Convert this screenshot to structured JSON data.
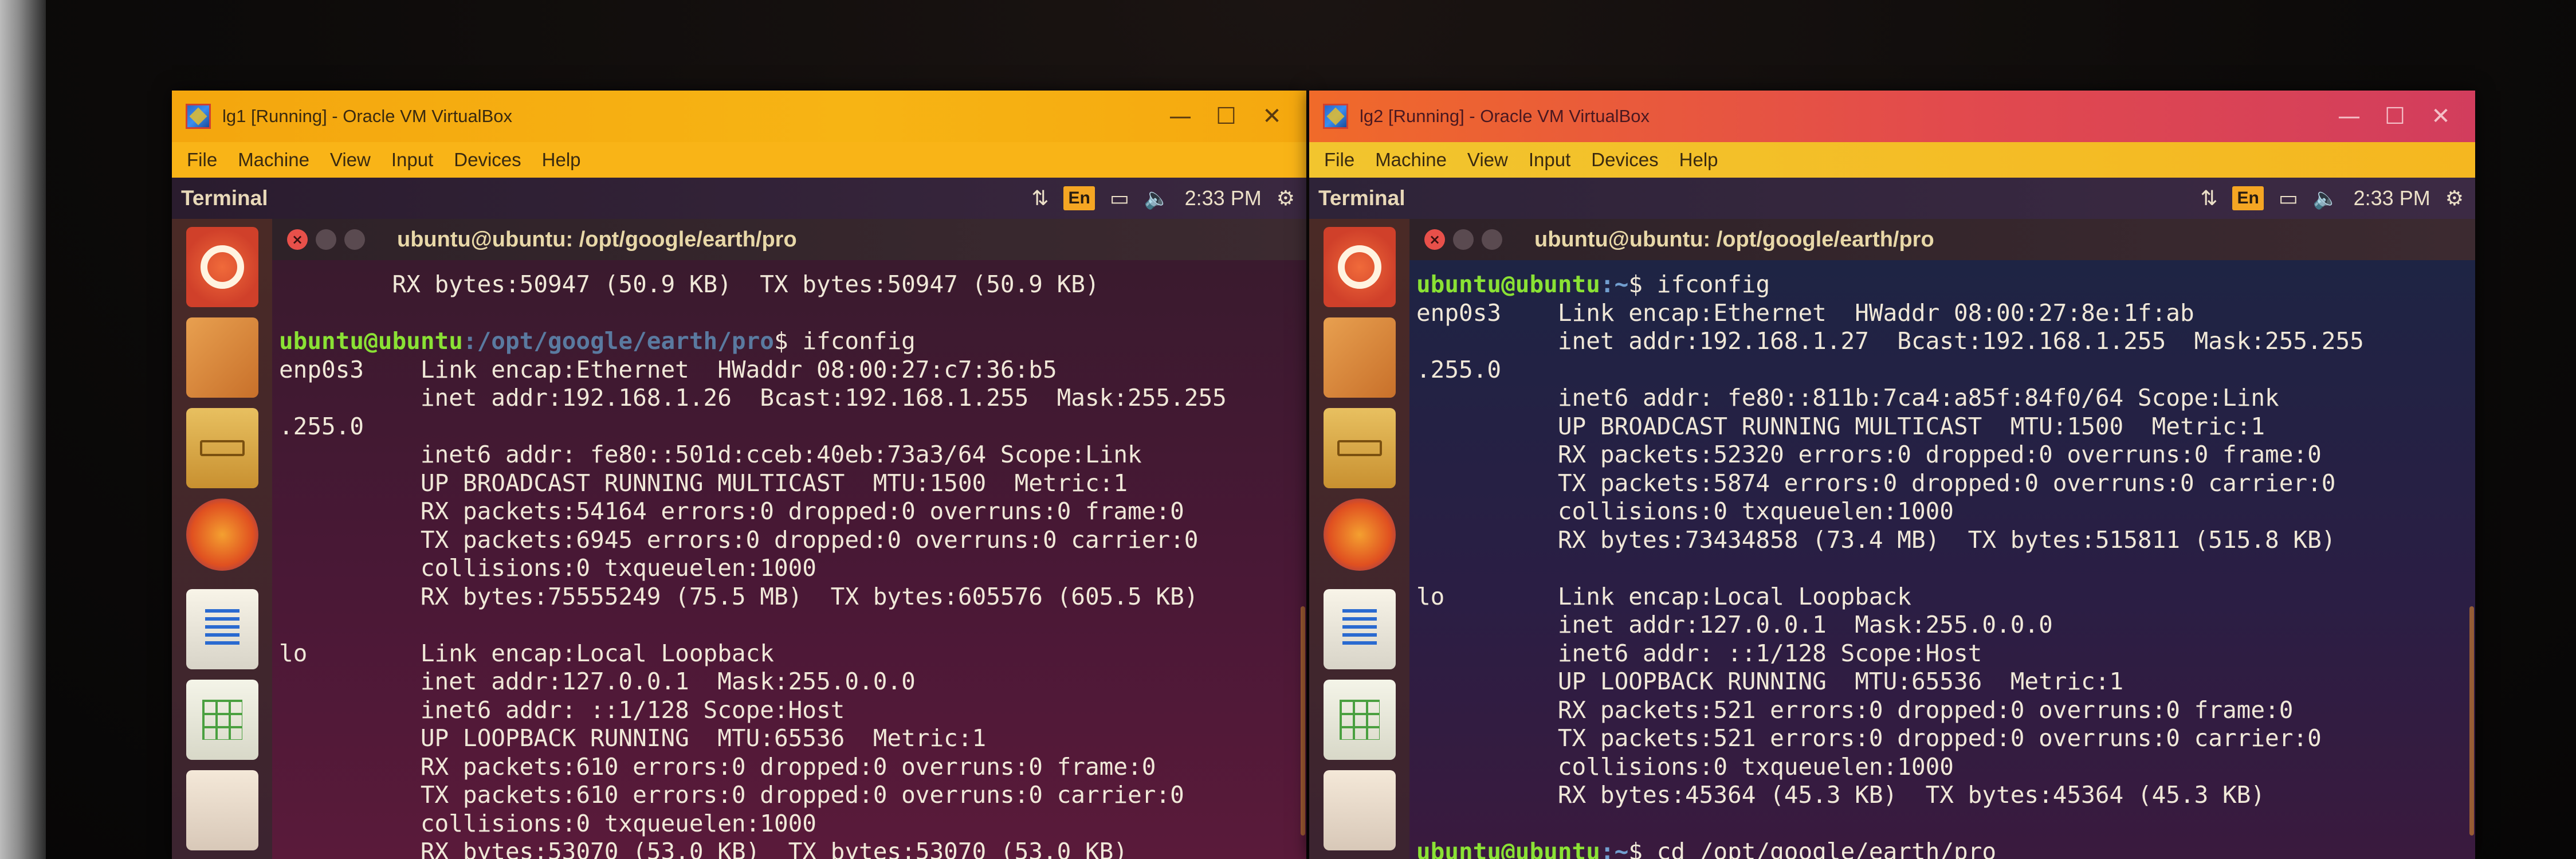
{
  "screen": {
    "background": "#0d0b0a"
  },
  "windows": [
    {
      "title": "lg1 [Running] - Oracle VM VirtualBox",
      "menu": [
        "File",
        "Machine",
        "View",
        "Input",
        "Devices",
        "Help"
      ],
      "controls": {
        "minimize": "—",
        "maximize": "☐",
        "close": "✕"
      },
      "guest_bar": {
        "app_title": "Terminal",
        "indicators": [
          "network-icon",
          "En",
          "battery-icon",
          "volume-icon"
        ],
        "lang": "En",
        "clock": "2:33 PM"
      },
      "launcher": [
        "ubuntu-dash-icon",
        "software-center-icon",
        "files-icon",
        "firefox-icon",
        "writer-icon",
        "calc-icon",
        "impress-icon"
      ],
      "terminal": {
        "title": "ubuntu@ubuntu: /opt/google/earth/pro",
        "lines": [
          {
            "text": "        RX bytes:50947 (50.9 KB)  TX bytes:50947 (50.9 KB)"
          },
          {
            "text": ""
          },
          {
            "user": "ubuntu@ubuntu",
            "path": ":/opt/google/earth/pro",
            "cmd": "$ ifconfig"
          },
          {
            "text": "enp0s3    Link encap:Ethernet  HWaddr 08:00:27:c7:36:b5"
          },
          {
            "text": "          inet addr:192.168.1.26  Bcast:192.168.1.255  Mask:255.255"
          },
          {
            "text": ".255.0"
          },
          {
            "text": "          inet6 addr: fe80::501d:cceb:40eb:73a3/64 Scope:Link"
          },
          {
            "text": "          UP BROADCAST RUNNING MULTICAST  MTU:1500  Metric:1"
          },
          {
            "text": "          RX packets:54164 errors:0 dropped:0 overruns:0 frame:0"
          },
          {
            "text": "          TX packets:6945 errors:0 dropped:0 overruns:0 carrier:0"
          },
          {
            "text": "          collisions:0 txqueuelen:1000"
          },
          {
            "text": "          RX bytes:75555249 (75.5 MB)  TX bytes:605576 (605.5 KB)"
          },
          {
            "text": ""
          },
          {
            "text": "lo        Link encap:Local Loopback"
          },
          {
            "text": "          inet addr:127.0.0.1  Mask:255.0.0.0"
          },
          {
            "text": "          inet6 addr: ::1/128 Scope:Host"
          },
          {
            "text": "          UP LOOPBACK RUNNING  MTU:65536  Metric:1"
          },
          {
            "text": "          RX packets:610 errors:0 dropped:0 overruns:0 frame:0"
          },
          {
            "text": "          TX packets:610 errors:0 dropped:0 overruns:0 carrier:0"
          },
          {
            "text": "          collisions:0 txqueuelen:1000"
          },
          {
            "text": "          RX bytes:53070 (53.0 KB)  TX bytes:53070 (53.0 KB)"
          }
        ]
      }
    },
    {
      "title": "lg2 [Running] - Oracle VM VirtualBox",
      "menu": [
        "File",
        "Machine",
        "View",
        "Input",
        "Devices",
        "Help"
      ],
      "controls": {
        "minimize": "—",
        "maximize": "☐",
        "close": "✕"
      },
      "guest_bar": {
        "app_title": "Terminal",
        "indicators": [
          "network-icon",
          "En",
          "battery-icon",
          "volume-icon"
        ],
        "lang": "En",
        "clock": "2:33 PM"
      },
      "launcher": [
        "ubuntu-dash-icon",
        "software-center-icon",
        "files-icon",
        "firefox-icon",
        "writer-icon",
        "calc-icon",
        "impress-icon"
      ],
      "terminal": {
        "title": "ubuntu@ubuntu: /opt/google/earth/pro",
        "lines": [
          {
            "user": "ubuntu@ubuntu",
            "path": ":~",
            "cmd": "$ ifconfig"
          },
          {
            "text": "enp0s3    Link encap:Ethernet  HWaddr 08:00:27:8e:1f:ab"
          },
          {
            "text": "          inet addr:192.168.1.27  Bcast:192.168.1.255  Mask:255.255"
          },
          {
            "text": ".255.0"
          },
          {
            "text": "          inet6 addr: fe80::811b:7ca4:a85f:84f0/64 Scope:Link"
          },
          {
            "text": "          UP BROADCAST RUNNING MULTICAST  MTU:1500  Metric:1"
          },
          {
            "text": "          RX packets:52320 errors:0 dropped:0 overruns:0 frame:0"
          },
          {
            "text": "          TX packets:5874 errors:0 dropped:0 overruns:0 carrier:0"
          },
          {
            "text": "          collisions:0 txqueuelen:1000"
          },
          {
            "text": "          RX bytes:73434858 (73.4 MB)  TX bytes:515811 (515.8 KB)"
          },
          {
            "text": ""
          },
          {
            "text": "lo        Link encap:Local Loopback"
          },
          {
            "text": "          inet addr:127.0.0.1  Mask:255.0.0.0"
          },
          {
            "text": "          inet6 addr: ::1/128 Scope:Host"
          },
          {
            "text": "          UP LOOPBACK RUNNING  MTU:65536  Metric:1"
          },
          {
            "text": "          RX packets:521 errors:0 dropped:0 overruns:0 frame:0"
          },
          {
            "text": "          TX packets:521 errors:0 dropped:0 overruns:0 carrier:0"
          },
          {
            "text": "          collisions:0 txqueuelen:1000"
          },
          {
            "text": "          RX bytes:45364 (45.3 KB)  TX bytes:45364 (45.3 KB)"
          },
          {
            "text": ""
          },
          {
            "user": "ubuntu@ubuntu",
            "path": ":~",
            "cmd": "$ cd /opt/google/earth/pro"
          }
        ]
      }
    }
  ]
}
